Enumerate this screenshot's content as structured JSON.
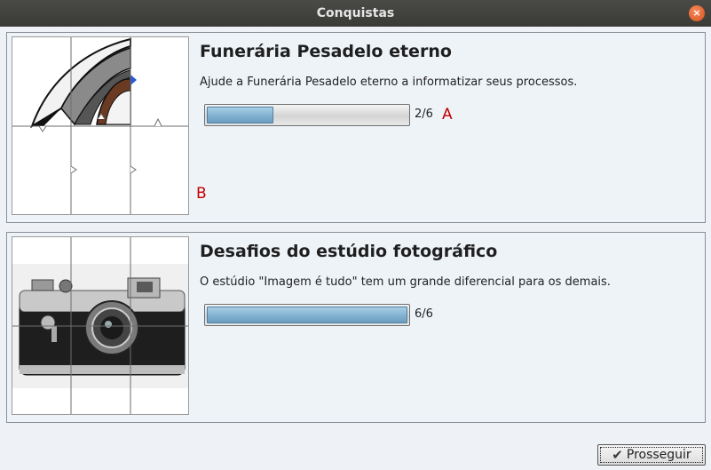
{
  "window": {
    "title": "Conquistas",
    "close_icon": "×"
  },
  "achievements": [
    {
      "title": "Funerária Pesadelo eterno",
      "description": "Ajude a Funerária Pesadelo eterno a informatizar seus processos.",
      "progress_text": "2/6",
      "progress_fraction": 0.333,
      "image": "puzzle-funeral-image"
    },
    {
      "title": "Desafios do estúdio fotográfico",
      "description": "O estúdio \"Imagem é tudo\" tem um grande diferencial para os demais.",
      "progress_text": "6/6",
      "progress_fraction": 1.0,
      "image": "puzzle-camera-image"
    }
  ],
  "annotations": {
    "marker_a": "A",
    "marker_b": "B"
  },
  "footer": {
    "continue_label": "Prosseguir",
    "continue_icon": "check-icon"
  },
  "colors": {
    "progress_fill": "#84b3d2",
    "annotation": "#c20000",
    "titlebar": "#3f3f3c"
  }
}
